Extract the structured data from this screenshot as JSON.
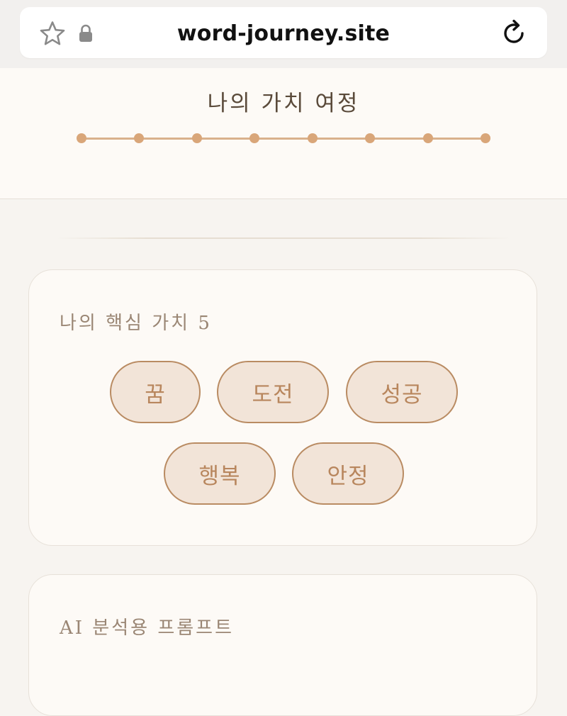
{
  "browser": {
    "url": "word-journey.site",
    "icons": [
      "star-icon",
      "lock-icon",
      "reload-icon"
    ]
  },
  "header": {
    "title": "나의 가치 여정",
    "progress": {
      "steps_total": 8,
      "steps_completed": 8
    }
  },
  "values_card": {
    "title": "나의 핵심 가치 5",
    "values": [
      "꿈",
      "도전",
      "성공",
      "행복",
      "안정"
    ]
  },
  "prompt_card": {
    "title": "AI 분석용 프롬프트"
  },
  "colors": {
    "background": "#f7f4f0",
    "card": "#fdfaf6",
    "accent": "#d9a679",
    "chip_fill": "#f2e4d8",
    "chip_border": "#b98b62",
    "chip_text": "#b8865d"
  }
}
